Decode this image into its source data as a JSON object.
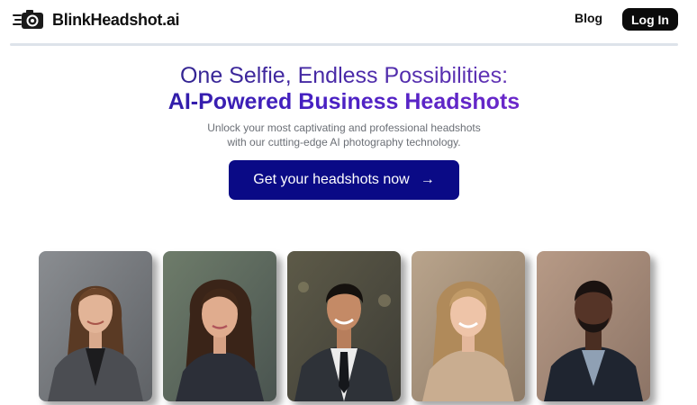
{
  "header": {
    "brand": "BlinkHeadshot.ai",
    "logo_icon": "camera-speed-icon",
    "nav": {
      "blog_label": "Blog",
      "login_label": "Log In"
    }
  },
  "hero": {
    "title_line1": "One Selfie, Endless Possibilities:",
    "title_line2": "AI-Powered Business Headshots",
    "subtitle_line1": "Unlock your most captivating and professional headshots",
    "subtitle_line2": "with our cutting-edge AI photography technology.",
    "cta_label": "Get your headshots now",
    "cta_icon": "arrow-right-icon"
  },
  "gallery": {
    "images": [
      "headshot-woman-brown-hair-gray-blazer",
      "headshot-woman-long-dark-hair",
      "headshot-man-suit-tie",
      "headshot-woman-blonde-hair",
      "headshot-man-beard-dark-suit"
    ]
  },
  "colors": {
    "cta_background": "#0a0a86",
    "login_background": "#0b0b0b",
    "title_gradient_start": "#181a8a",
    "title_gradient_end": "#8a2fd0"
  }
}
